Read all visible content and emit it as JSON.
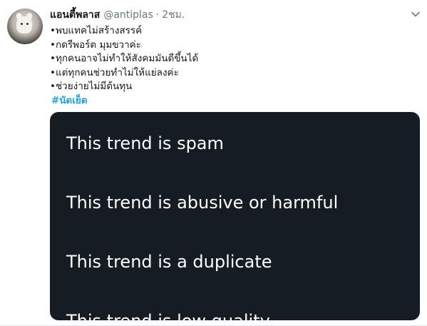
{
  "tweet": {
    "display_name": "แอนตี้พลาส",
    "handle": "@antiplas",
    "separator": "·",
    "time": "2ชม.",
    "lines": [
      "•พบแทคไม่สร้างสรรค์",
      "•กดรีพอร์ต มุมขวาค่ะ",
      "•ทุกคนอาจไม่ทำให้สังคมมันดีขึ้นได้",
      "•แต่ทุกคนช่วยทำไม่ให้แย่ลงค่ะ",
      "•ช่วยง่ายไม่มีต้นทุน"
    ],
    "hashtag": "#นัดเย็ด",
    "icons": {
      "avatar": "cat-avatar",
      "menu": "chevron-down-icon"
    }
  },
  "report_menu": {
    "items": [
      "This trend is spam",
      "This trend is abusive or harmful",
      "This trend is a duplicate",
      "This trend is low quality"
    ]
  },
  "colors": {
    "name": "#14171a",
    "muted": "#657786",
    "hashtag": "#1da1f2",
    "menu_background": "#151c24",
    "menu_text": "#ffffff"
  }
}
